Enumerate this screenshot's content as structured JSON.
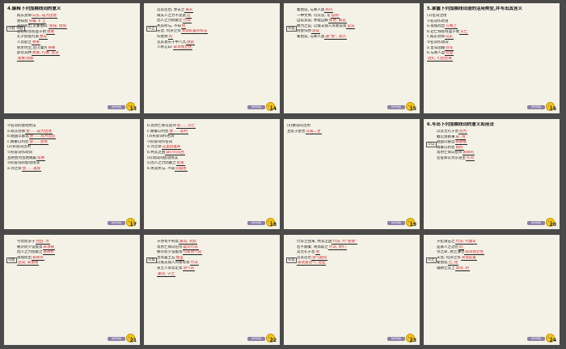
{
  "slides": [
    {
      "number": "13",
      "title": "4.解释下列加横线词的意义",
      "side": "①封 ②欲",
      "lines": [
        {
          "t": "既东封郑",
          "a": "向东, 成为边境"
        },
        {
          "t": "君知封",
          "a": "分疆, 扩土"
        },
        {
          "t": "夜缒而出,见秦伯曰:",
          "a": "加强, 增加"
        },
        {
          "t": "若亡郑而有益于君",
          "a": "想要"
        },
        {
          "t": "孔子欲居九夷",
          "a": "想去"
        },
        {
          "t": "人皆欲之",
          "a": "想要"
        },
        {
          "t": "秋水时至,百川灌河",
          "a": "将要"
        },
        {
          "t": "欲穷其林",
          "a": "想要, 打算, 追求"
        },
        {
          "t": "",
          "a": "需要,随意"
        }
      ]
    },
    {
      "number": "14",
      "title": "",
      "side": "③之",
      "lines": [
        {
          "t": "吾其还也, 亦去之",
          "a": "离开"
        },
        {
          "t": "微夫人之力不及此",
          "a": "这"
        },
        {
          "t": "因人之力而敝之",
          "a": "代词"
        },
        {
          "t": "失其所与, 不知",
          "a": "他"
        },
        {
          "t": "夫晋, 何厌之有",
          "a": "宾语前置的标志"
        },
        {
          "t": "作者简",
          "a": "的"
        },
        {
          "t": "见其发矢十中八九",
          "a": "放箭"
        },
        {
          "t": "人称言曰:",
          "a": "取消独立性"
        }
      ]
    },
    {
      "number": "15",
      "title": "",
      "side": "④说",
      "lines": [
        {
          "t": "秦伯说, 与郑人盟",
          "a": "高兴"
        },
        {
          "t": "一种文体, 可以议, 论",
          "a": "说明"
        },
        {
          "t": "自说其说, 亦能自解",
          "a": "陈述, 解说"
        },
        {
          "t": "故为之说, 以俟夫观人风者得焉",
          "a": "说法"
        },
        {
          "t": "则会归原",
          "a": "游说"
        },
        {
          "t": "秦伯说, 与郑人盟",
          "a": "通“悦”, 高兴"
        }
      ]
    },
    {
      "number": "16",
      "title": "5.掌握下列加横线词语的活用类型,并写出其含义",
      "side": "",
      "lines": [
        {
          "t": "(1)名词活用",
          "a": ""
        },
        {
          "t": "①名词作状语",
          "a": ""
        },
        {
          "t": "a.夜缒而出",
          "a": "在晚上"
        },
        {
          "t": "b.若亡郑而有益于君",
          "a": "灭亡"
        },
        {
          "t": "c.既东封郑",
          "a": "向东"
        },
        {
          "t": "②名词作动词",
          "a": ""
        },
        {
          "t": "a.晋军函陵",
          "a": "驻军"
        },
        {
          "t": "b.与郑人盟",
          "a": "结盟"
        },
        {
          "t": "",
          "a": "驻扎, 打起仗来"
        }
      ]
    },
    {
      "number": "17",
      "title": "",
      "side": "",
      "lines": [
        {
          "t": "③名词的使动用法",
          "a": ""
        },
        {
          "t": "a.既东封郑",
          "a": "使……成为边境"
        },
        {
          "t": "b.越国以鄙远",
          "a": "使……成为边邑"
        },
        {
          "t": "c.阙秦以利晋",
          "a": "使……受损"
        },
        {
          "t": "(2)形容词活用",
          "a": ""
        },
        {
          "t": "①形容词作动词",
          "a": ""
        },
        {
          "t": "且君尝为晋君赐矣",
          "a": "恩惠"
        },
        {
          "t": "②形容词的使动用法",
          "a": ""
        },
        {
          "t": "a.邻之厚",
          "a": "使……雄厚"
        }
      ]
    },
    {
      "number": "18",
      "title": "",
      "side": "",
      "lines": [
        {
          "t": "b.焉用亡郑以陪邻",
          "a": "使……灭亡"
        },
        {
          "t": "c.阙秦以利晋",
          "a": "使……获利"
        },
        {
          "t": "(3)形容词作名词",
          "a": ""
        },
        {
          "t": "①形容词作名词",
          "a": ""
        },
        {
          "t": "a.邻之厚",
          "a": "这里指雄厚"
        },
        {
          "t": "b.共其乏困",
          "a": "缺少的东西"
        },
        {
          "t": "(4)动词的使动用法",
          "a": ""
        },
        {
          "t": "a.因人之力而敝之",
          "a": "损害"
        },
        {
          "t": "b.失其所与, 不知",
          "a": "同盟者"
        }
      ]
    },
    {
      "number": "19",
      "title": "",
      "side": "",
      "lines": [
        {
          "t": "(4)数词的活用",
          "a": ""
        },
        {
          "t": "且贰于楚也",
          "a": "从属二主"
        }
      ]
    },
    {
      "number": "20",
      "title": "6.写出下列加横线词的意义和用法",
      "side": "①以",
      "lines": [
        {
          "t": "以其无礼于晋",
          "a": "因为"
        },
        {
          "t": "敢以烦执事",
          "a": "拿, 用"
        },
        {
          "t": "越国以鄙远",
          "a": "表顺接"
        },
        {
          "t": "阙秦以利晋",
          "a": "目的"
        },
        {
          "t": "焉用亡郑以陪邻",
          "a": "表目的"
        },
        {
          "t": "若舍郑以为东道主",
          "a": "作为"
        }
      ]
    },
    {
      "number": "21",
      "title": "",
      "side": "②而",
      "lines": [
        {
          "t": "今急而求子",
          "a": "然后, 才"
        },
        {
          "t": "朝济而夕设版焉",
          "a": "表承接"
        },
        {
          "t": "因人之力而敝之",
          "a": "表转折"
        },
        {
          "t": "夜缒而出",
          "a": "表修饰"
        },
        {
          "t": "",
          "a": "连词, 表承接"
        }
      ]
    },
    {
      "number": "22",
      "title": "",
      "side": "③焉",
      "lines": [
        {
          "t": "子亦有不利焉",
          "a": "兼词, 对此"
        },
        {
          "t": "焉用亡郑以陪邻",
          "a": "疑问代词"
        },
        {
          "t": "朝济而夕设版焉",
          "a": "句末语气词"
        },
        {
          "t": "且焉置土石",
          "a": "哪里"
        },
        {
          "t": "以俟夫观人风者得焉",
          "a": "代词"
        },
        {
          "t": "永之人争奔走焉",
          "a": "语气词"
        },
        {
          "t": "",
          "a": "兼词, 于之"
        }
      ]
    },
    {
      "number": "23",
      "title": "",
      "side": "④其",
      "lines": [
        {
          "t": "行李之往来, 共其乏困",
          "a": "代词, 代“使者”"
        },
        {
          "t": "若不阙秦, 将焉取之",
          "a": "代词, 他们"
        },
        {
          "t": "其无礼于晋",
          "a": "他"
        },
        {
          "t": "吾其还也",
          "a": "语气副词"
        },
        {
          "t": "",
          "a": "表商量语气, 还是"
        }
      ]
    },
    {
      "number": "24",
      "title": "",
      "side": "⑤之",
      "lines": [
        {
          "t": "子犯请击之",
          "a": "代词, 代秦军"
        },
        {
          "t": "是寡人之过也",
          "a": "的"
        },
        {
          "t": "邻之厚, 君之薄也",
          "a": "取消独立性"
        },
        {
          "t": "夫晋, 何厌之有",
          "a": "宾语前置"
        },
        {
          "t": "秦伯说",
          "a": "之, 往"
        },
        {
          "t": "辍耕之垄上",
          "a": "动词, 到"
        }
      ]
    }
  ],
  "footer": {
    "badge_label": "时代学案"
  }
}
